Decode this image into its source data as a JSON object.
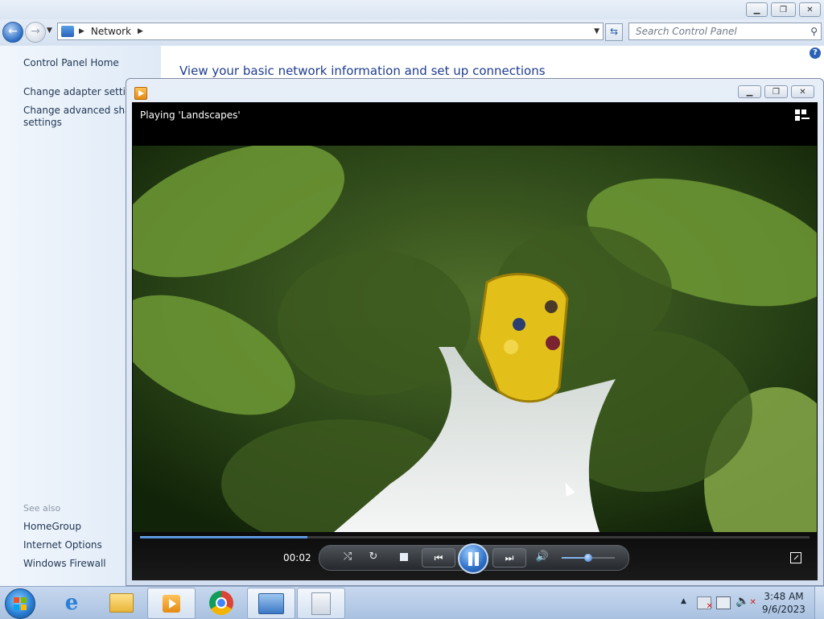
{
  "control_panel": {
    "address_crumb": "Network",
    "search_placeholder": "Search Control Panel",
    "left_links": [
      "Control Panel Home",
      "Change adapter settings",
      "Change advanced sharing settings"
    ],
    "see_also_title": "See also",
    "see_also_links": [
      "HomeGroup",
      "Internet Options",
      "Windows Firewall"
    ],
    "heading": "View your basic network information and set up connections"
  },
  "media_player": {
    "now_playing": "Playing 'Landscapes'",
    "time_elapsed": "00:02",
    "progress_fraction": 0.25,
    "volume_fraction": 0.5
  },
  "taskbar": {
    "clock_time": "3:48 AM",
    "clock_date": "9/6/2023",
    "apps": [
      "internet-explorer",
      "windows-explorer",
      "windows-media-player",
      "google-chrome",
      "control-panel",
      "notepad"
    ]
  },
  "colors": {
    "accent": "#2b6cc3",
    "link": "#1f3553",
    "heading": "#1e3d8f"
  }
}
